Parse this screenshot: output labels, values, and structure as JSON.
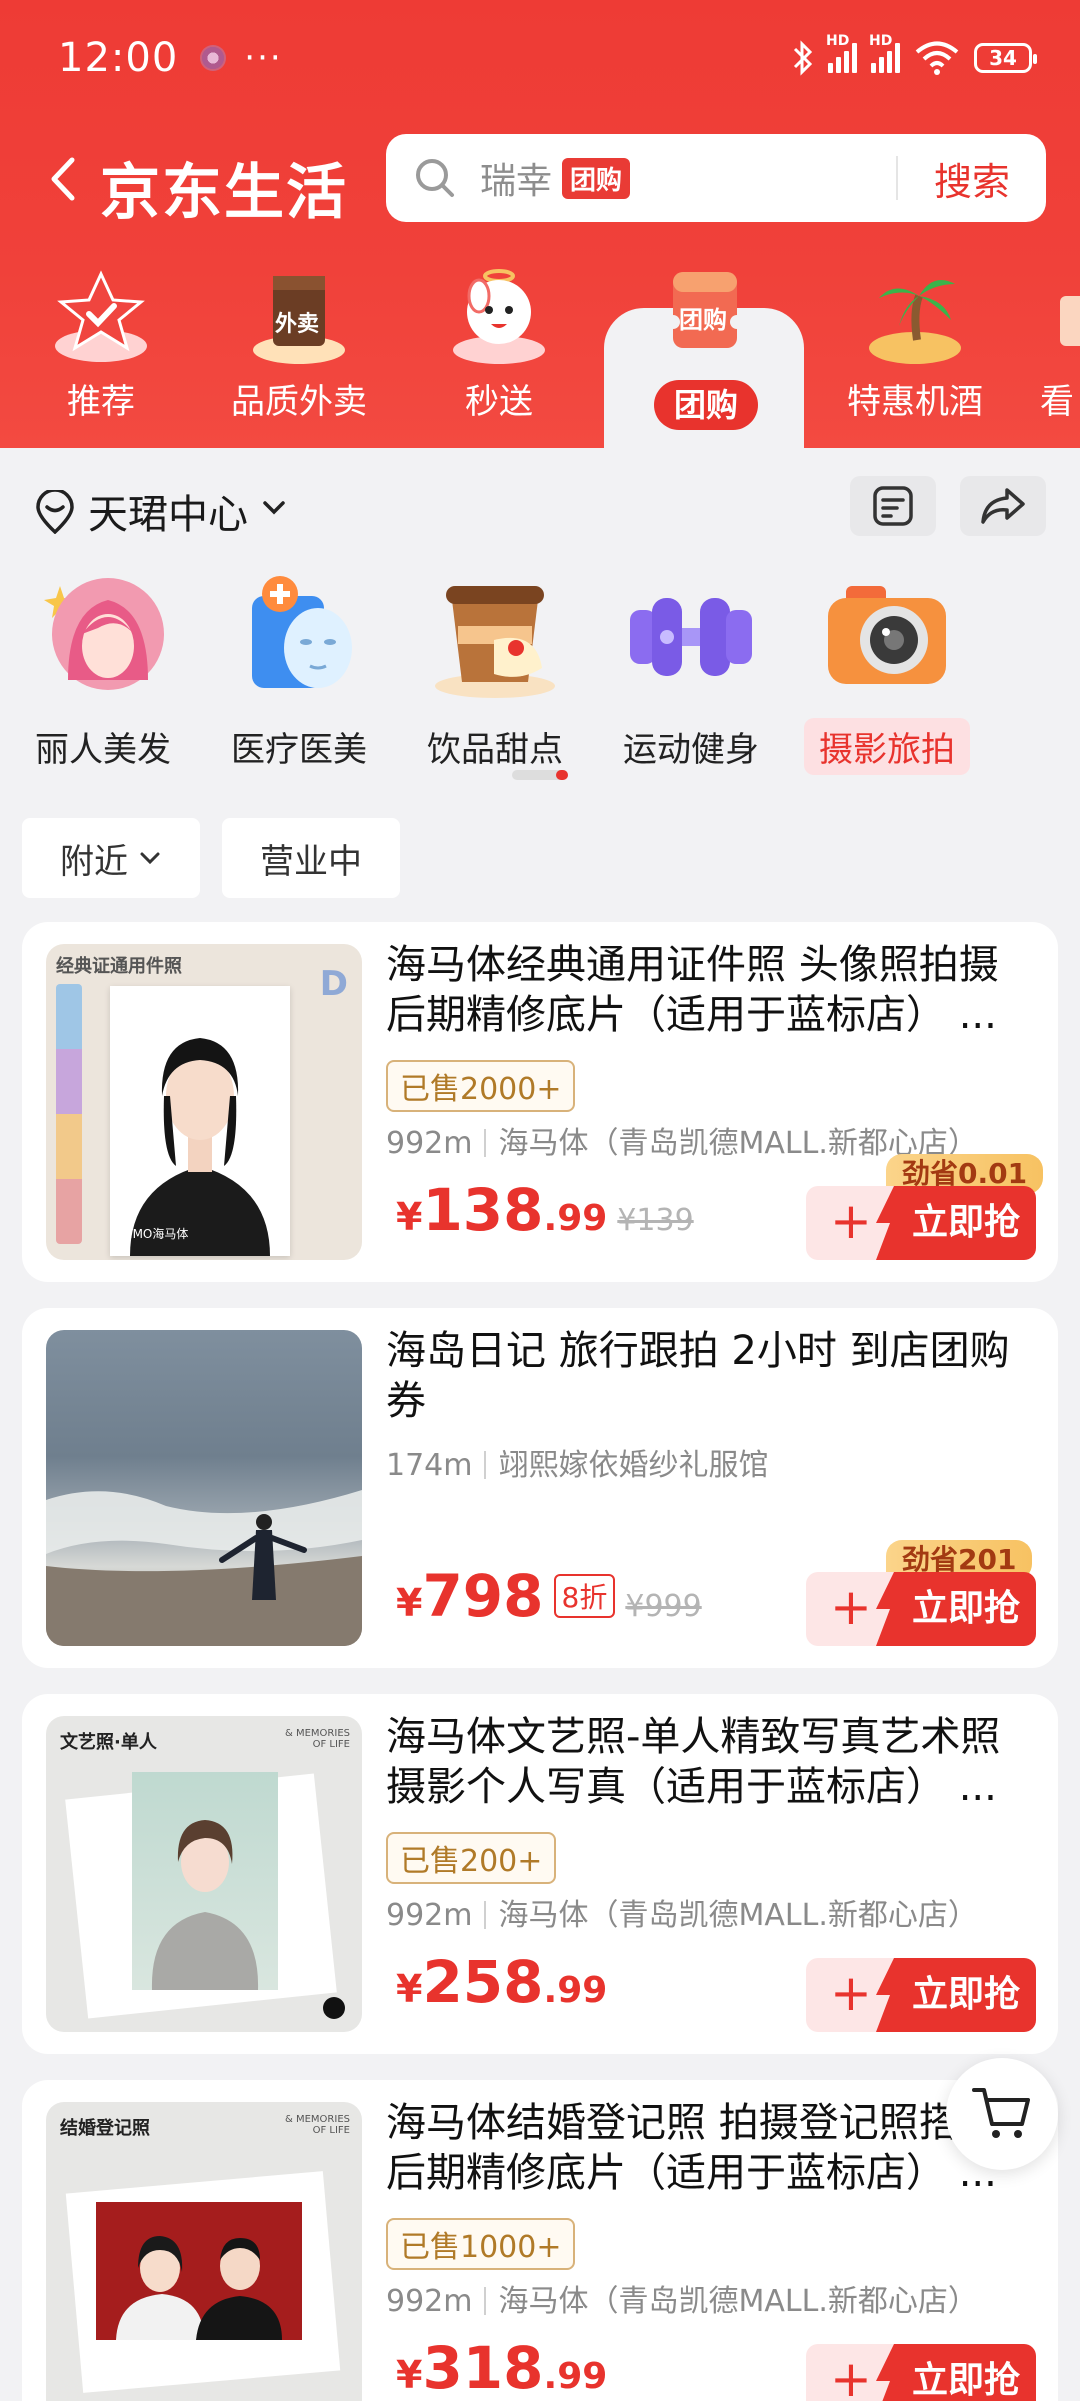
{
  "status_bar": {
    "time": "12:00",
    "more": "···",
    "battery": "34",
    "net1": "HD",
    "net2": "HD"
  },
  "header": {
    "title": "京东生活",
    "search": {
      "placeholder": "瑞幸",
      "tag": "团购",
      "button": "搜索"
    }
  },
  "tabs": [
    {
      "label": "推荐",
      "icon": "star-check-icon"
    },
    {
      "label": "品质外卖",
      "icon": "takeout-bag-icon",
      "icon_text": "外卖"
    },
    {
      "label": "秒送",
      "icon": "joy-mascot-icon"
    },
    {
      "label": "团购",
      "icon": "coupon-icon",
      "icon_text": "团购",
      "active": true
    },
    {
      "label": "特惠机酒",
      "icon": "palm-island-icon"
    },
    {
      "label": "看",
      "icon": "partial-tab-icon"
    }
  ],
  "location": {
    "name": "天珺中心"
  },
  "categories": [
    {
      "label": "丽人美发",
      "icon": "beauty-girl-icon"
    },
    {
      "label": "医疗医美",
      "icon": "medical-mask-icon"
    },
    {
      "label": "饮品甜点",
      "icon": "drink-dessert-icon"
    },
    {
      "label": "运动健身",
      "icon": "dumbbell-icon"
    },
    {
      "label": "摄影旅拍",
      "icon": "camera-icon",
      "active": true
    }
  ],
  "filters": {
    "nearby": "附近",
    "open": "营业中"
  },
  "products": [
    {
      "title": "海马体经典通用证件照 头像照拍摄后期精修底片（适用于蓝标店） ...",
      "sold": "已售2000+",
      "distance": "992m",
      "shop": "海马体（青岛凯德MALL.新都心店）",
      "currency": "¥",
      "price_int": "138",
      "price_dec": ".99",
      "orig": "¥139",
      "save": "劲省0.01",
      "buy": "立即抢",
      "thumb_caption": "经典证通用件照",
      "thumb_logo": "HIMO海马体"
    },
    {
      "title": "海岛日记 旅行跟拍 2小时 到店团购券",
      "distance": "174m",
      "shop": "翊熙嫁依婚纱礼服馆",
      "currency": "¥",
      "price_int": "798",
      "discount": "8折",
      "orig": "¥999",
      "save": "劲省201",
      "buy": "立即抢"
    },
    {
      "title": "海马体文艺照-单人精致写真艺术照摄影个人写真（适用于蓝标店） ...",
      "sold": "已售200+",
      "distance": "992m",
      "shop": "海马体（青岛凯德MALL.新都心店）",
      "currency": "¥",
      "price_int": "258",
      "price_dec": ".99",
      "buy": "立即抢",
      "thumb_caption": "文艺照·单人",
      "thumb_tag": "& MEMORIES OF LIFE"
    },
    {
      "title": "海马体结婚登记照 拍摄登记照搭配后期精修底片（适用于蓝标店） ...",
      "sold": "已售1000+",
      "distance": "992m",
      "shop": "海马体（青岛凯德MALL.新都心店）",
      "currency": "¥",
      "price_int": "318",
      "price_dec": ".99",
      "buy": "立即抢",
      "thumb_caption": "结婚登记照",
      "thumb_tag": "& MEMORIES OF LIFE"
    }
  ],
  "colors": {
    "brand_red": "#e8332d",
    "page_bg": "#f2f2f4",
    "gold": "#f7c262"
  }
}
